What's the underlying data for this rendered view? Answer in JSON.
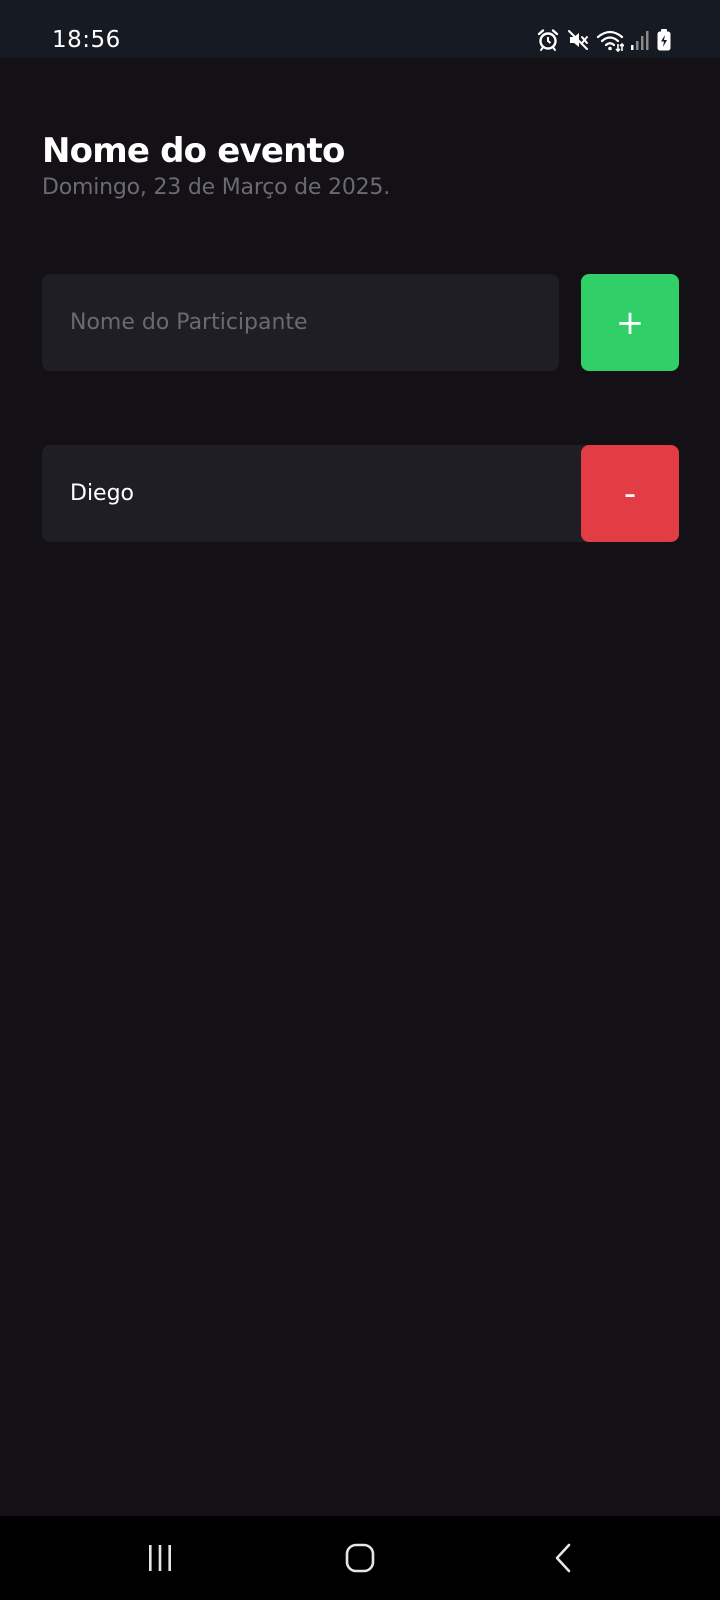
{
  "status_bar": {
    "time": "18:56",
    "icons": [
      "alarm-icon",
      "mute-icon",
      "wifi-icon",
      "signal-icon",
      "battery-charging-icon"
    ]
  },
  "event": {
    "title": "Nome do evento",
    "date": "Domingo, 23 de Março de 2025."
  },
  "form": {
    "participant_input": {
      "value": "",
      "placeholder": "Nome do Participante"
    },
    "add_button_label": "+",
    "add_button_color": "#31CF67"
  },
  "participants": [
    {
      "name": "Diego",
      "remove_label": "-"
    }
  ],
  "colors": {
    "background": "#131016",
    "card": "#1F1E25",
    "muted_text": "#6B6A72",
    "remove": "#E23C44"
  },
  "nav_bar": {
    "buttons": [
      "recents-icon",
      "home-icon",
      "back-icon"
    ]
  }
}
